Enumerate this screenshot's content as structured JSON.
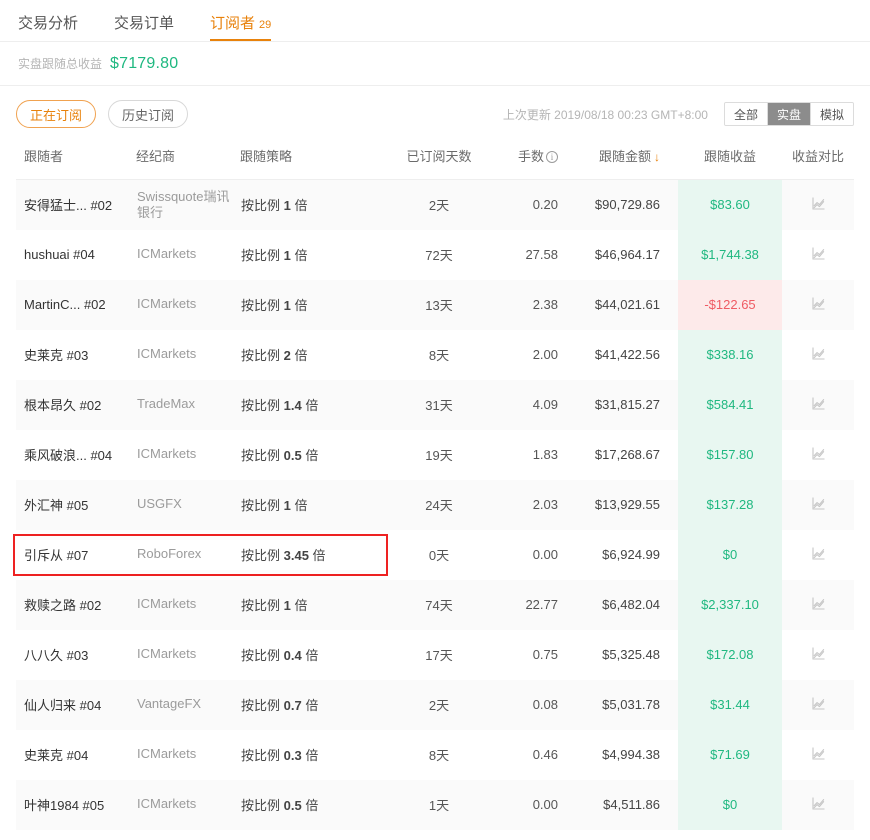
{
  "tabs": [
    {
      "label": "交易分析",
      "count": "",
      "active": false
    },
    {
      "label": "交易订单",
      "count": "",
      "active": false
    },
    {
      "label": "订阅者",
      "count": "29",
      "active": true
    }
  ],
  "summary": {
    "label": "实盘跟随总收益",
    "value": "$7179.80",
    "value_color": "#1fb880"
  },
  "filters": {
    "pills": [
      {
        "label": "正在订阅",
        "active": true
      },
      {
        "label": "历史订阅",
        "active": false
      }
    ],
    "updated_text": "上次更新 2019/08/18 00:23 GMT+8:00",
    "segments": [
      {
        "label": "全部",
        "active": false
      },
      {
        "label": "实盘",
        "active": true
      },
      {
        "label": "模拟",
        "active": false
      }
    ]
  },
  "table": {
    "headers": {
      "follower": "跟随者",
      "broker": "经纪商",
      "strategy": "跟随策略",
      "days": "已订阅天数",
      "lots": "手数",
      "lots_info_icon": "info-icon",
      "amount": "跟随金额",
      "amount_sort_icon": "↓",
      "profit": "跟随收益",
      "chart": "收益对比"
    },
    "rows": [
      {
        "follower": "安得猛士... #02",
        "broker": "Swissquote瑞讯银行",
        "strategy_prefix": "按比例",
        "strategy_mult": "1",
        "strategy_suffix": "倍",
        "days": "2天",
        "lots": "0.20",
        "amount": "$90,729.86",
        "profit": "$83.60",
        "profit_sign": "pos"
      },
      {
        "follower": "hushuai #04",
        "broker": "ICMarkets",
        "strategy_prefix": "按比例",
        "strategy_mult": "1",
        "strategy_suffix": "倍",
        "days": "72天",
        "lots": "27.58",
        "amount": "$46,964.17",
        "profit": "$1,744.38",
        "profit_sign": "pos"
      },
      {
        "follower": "MartinC... #02",
        "broker": "ICMarkets",
        "strategy_prefix": "按比例",
        "strategy_mult": "1",
        "strategy_suffix": "倍",
        "days": "13天",
        "lots": "2.38",
        "amount": "$44,021.61",
        "profit": "-$122.65",
        "profit_sign": "neg"
      },
      {
        "follower": "史莱克 #03",
        "broker": "ICMarkets",
        "strategy_prefix": "按比例",
        "strategy_mult": "2",
        "strategy_suffix": "倍",
        "days": "8天",
        "lots": "2.00",
        "amount": "$41,422.56",
        "profit": "$338.16",
        "profit_sign": "pos"
      },
      {
        "follower": "根本昂久 #02",
        "broker": "TradeMax",
        "strategy_prefix": "按比例",
        "strategy_mult": "1.4",
        "strategy_suffix": "倍",
        "days": "31天",
        "lots": "4.09",
        "amount": "$31,815.27",
        "profit": "$584.41",
        "profit_sign": "pos"
      },
      {
        "follower": "乘风破浪... #04",
        "broker": "ICMarkets",
        "strategy_prefix": "按比例",
        "strategy_mult": "0.5",
        "strategy_suffix": "倍",
        "days": "19天",
        "lots": "1.83",
        "amount": "$17,268.67",
        "profit": "$157.80",
        "profit_sign": "pos"
      },
      {
        "follower": "外汇神 #05",
        "broker": "USGFX",
        "strategy_prefix": "按比例",
        "strategy_mult": "1",
        "strategy_suffix": "倍",
        "days": "24天",
        "lots": "2.03",
        "amount": "$13,929.55",
        "profit": "$137.28",
        "profit_sign": "pos"
      },
      {
        "follower": "引斥从 #07",
        "broker": "RoboForex",
        "strategy_prefix": "按比例",
        "strategy_mult": "3.45",
        "strategy_suffix": "倍",
        "days": "0天",
        "lots": "0.00",
        "amount": "$6,924.99",
        "profit": "$0",
        "profit_sign": "pos"
      },
      {
        "follower": "救赎之路 #02",
        "broker": "ICMarkets",
        "strategy_prefix": "按比例",
        "strategy_mult": "1",
        "strategy_suffix": "倍",
        "days": "74天",
        "lots": "22.77",
        "amount": "$6,482.04",
        "profit": "$2,337.10",
        "profit_sign": "pos"
      },
      {
        "follower": "八八久 #03",
        "broker": "ICMarkets",
        "strategy_prefix": "按比例",
        "strategy_mult": "0.4",
        "strategy_suffix": "倍",
        "days": "17天",
        "lots": "0.75",
        "amount": "$5,325.48",
        "profit": "$172.08",
        "profit_sign": "pos"
      },
      {
        "follower": "仙人归来 #04",
        "broker": "VantageFX",
        "strategy_prefix": "按比例",
        "strategy_mult": "0.7",
        "strategy_suffix": "倍",
        "days": "2天",
        "lots": "0.08",
        "amount": "$5,031.78",
        "profit": "$31.44",
        "profit_sign": "pos"
      },
      {
        "follower": "史莱克 #04",
        "broker": "ICMarkets",
        "strategy_prefix": "按比例",
        "strategy_mult": "0.3",
        "strategy_suffix": "倍",
        "days": "8天",
        "lots": "0.46",
        "amount": "$4,994.38",
        "profit": "$71.69",
        "profit_sign": "pos"
      },
      {
        "follower": "叶神1984 #05",
        "broker": "ICMarkets",
        "strategy_prefix": "按比例",
        "strategy_mult": "0.5",
        "strategy_suffix": "倍",
        "days": "1天",
        "lots": "0.00",
        "amount": "$4,511.86",
        "profit": "$0",
        "profit_sign": "pos"
      }
    ]
  },
  "annotation": {
    "target_row_index": 7,
    "color": "#ee2222"
  },
  "colors": {
    "accent": "#e8820c",
    "positive": "#1fb880",
    "negative": "#ef5b63",
    "positive_bg": "#e8f7f1",
    "negative_bg": "#fdeaea",
    "row_alt_bg": "#fafafa"
  }
}
